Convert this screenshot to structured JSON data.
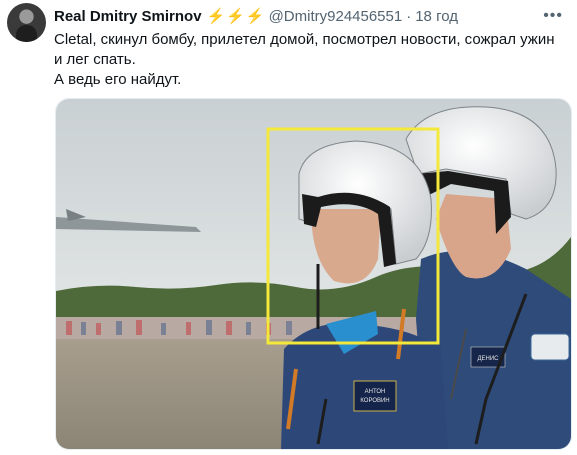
{
  "tweet": {
    "author_name": "Real Dmitry Smirnov",
    "badge": "⚡⚡⚡",
    "handle": "@Dmitry924456551",
    "separator": "·",
    "time": "18 год",
    "more_icon": "more-icon",
    "text_lines": [
      "Сletal, скинул бомбу, прилетел домой, посмотрел новости, сожрал ужин",
      "и лег спать.",
      "А ведь его найдут."
    ]
  },
  "photo": {
    "name_patch_left": [
      "АНТОН",
      "КОРОВИН"
    ],
    "name_patch_right": [
      "ДЕНИС"
    ],
    "highlight_color": "#f4e83a"
  }
}
